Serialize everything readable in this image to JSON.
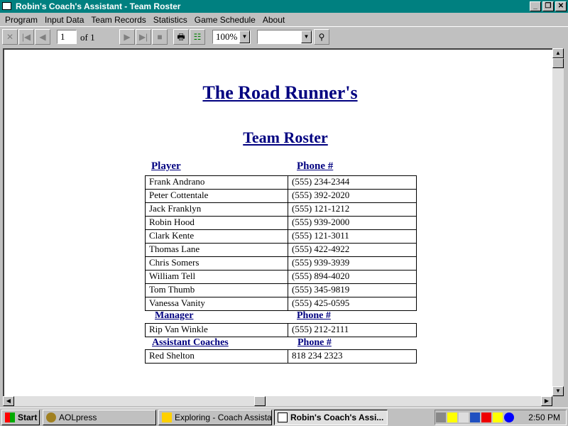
{
  "window": {
    "title": "Robin's Coach's Assistant - Team Roster"
  },
  "menu": [
    "Program",
    "Input Data",
    "Team Records",
    "Statistics",
    "Game Schedule",
    "About"
  ],
  "toolbar": {
    "page": "1",
    "page_of": "of 1",
    "zoom": "100%",
    "search": ""
  },
  "report": {
    "title": "The Road Runner's",
    "subtitle": "Team Roster",
    "player_header": "Player",
    "phone_header": "Phone #",
    "players": [
      {
        "name": "Frank Andrano",
        "phone": "(555) 234-2344"
      },
      {
        "name": "Peter Cottentale",
        "phone": "(555) 392-2020"
      },
      {
        "name": "Jack Franklyn",
        "phone": "(555) 121-1212"
      },
      {
        "name": "Robin Hood",
        "phone": "(555) 939-2000"
      },
      {
        "name": "Clark Kente",
        "phone": "(555) 121-3011"
      },
      {
        "name": "Thomas Lane",
        "phone": "(555) 422-4922"
      },
      {
        "name": "Chris Somers",
        "phone": "(555) 939-3939"
      },
      {
        "name": "William Tell",
        "phone": "(555) 894-4020"
      },
      {
        "name": "Tom  Thumb",
        "phone": "(555) 345-9819"
      },
      {
        "name": "Vanessa Vanity",
        "phone": "(555) 425-0595"
      }
    ],
    "manager_header": "Manager",
    "manager_phone_header": "Phone #",
    "manager": {
      "name": "Rip Van Winkle",
      "phone": "(555) 212-2111"
    },
    "coaches_header": "Assistant Coaches",
    "coaches_phone_header": "Phone #",
    "coach": {
      "name": "Red Shelton",
      "phone": "818 234 2323"
    }
  },
  "taskbar": {
    "start": "Start",
    "tasks": [
      "AOLpress",
      "Exploring - Coach Assistan...",
      "Robin's Coach's Assi..."
    ],
    "clock": "2:50 PM"
  }
}
